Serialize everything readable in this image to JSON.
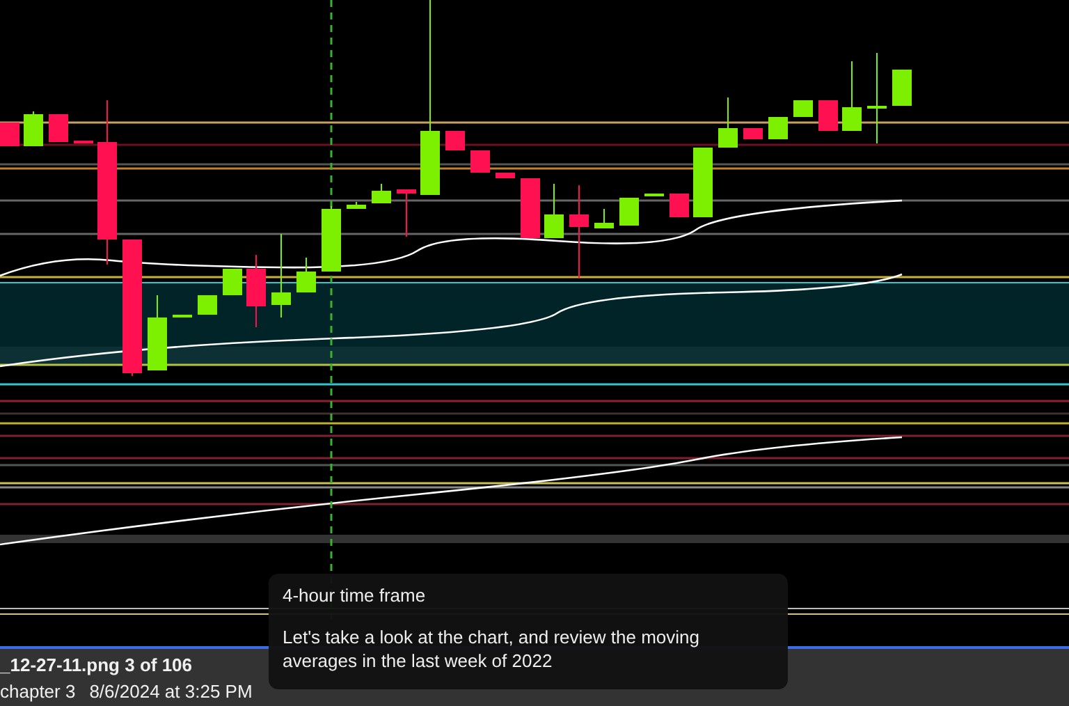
{
  "tooltip": {
    "title": "4-hour time frame",
    "body": "Let's take a look at the chart, and review the moving averages in the last week of 2022"
  },
  "viewer": {
    "file_info": "_12-27-11.png 3 of 106",
    "album": "chapter 3",
    "date": "8/6/2024 at 3:25 PM"
  }
}
